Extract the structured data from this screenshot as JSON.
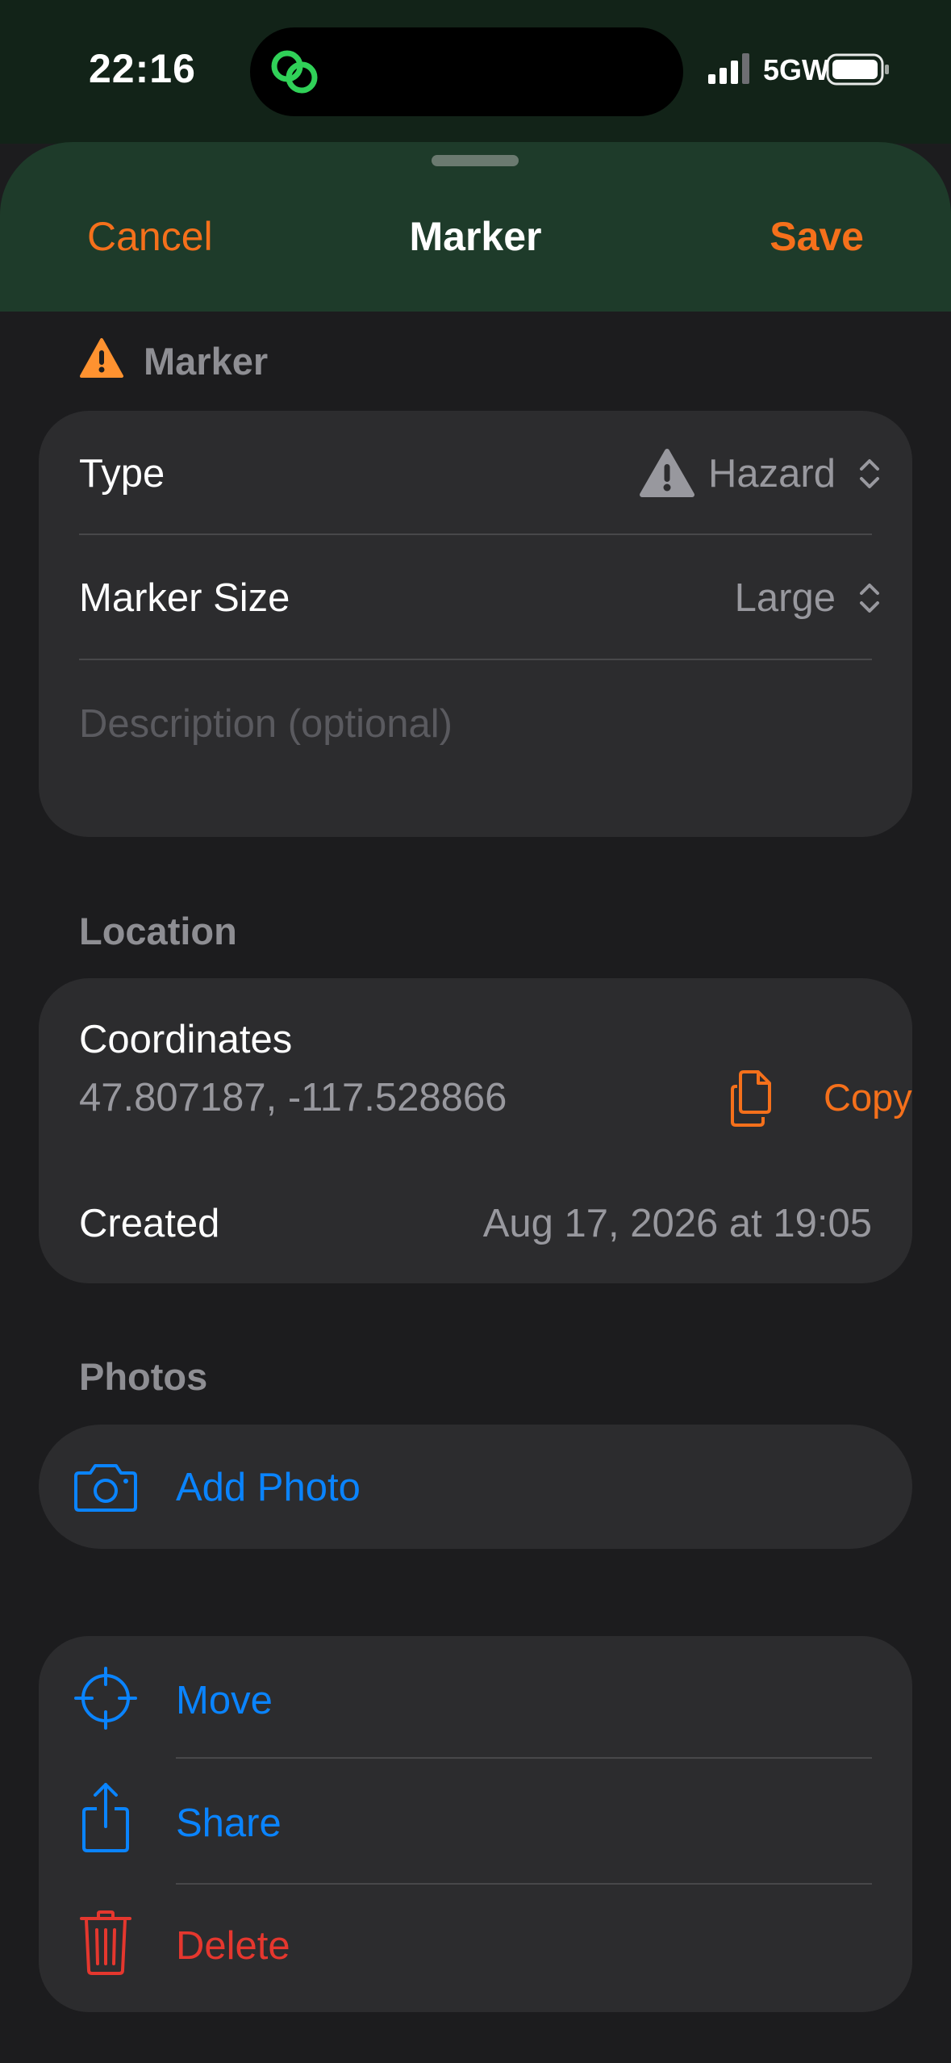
{
  "status_bar": {
    "time": "22:16",
    "network": "5GW",
    "island_icon": "linked-rings-icon"
  },
  "nav": {
    "cancel": "Cancel",
    "title": "Marker",
    "save": "Save"
  },
  "marker_section": {
    "header": "Marker",
    "header_icon": "warning-triangle-icon",
    "type_label": "Type",
    "type_value": "Hazard",
    "type_icon": "warning-triangle-icon",
    "size_label": "Marker Size",
    "size_value": "Large",
    "description_placeholder": "Description (optional)"
  },
  "location_section": {
    "header": "Location",
    "coordinates_label": "Coordinates",
    "coordinates_value": "47.807187, -117.528866",
    "copy_label": "Copy",
    "created_label": "Created",
    "created_value": "Aug 17, 2026 at 19:05"
  },
  "photos_section": {
    "header": "Photos",
    "add_photo": "Add Photo"
  },
  "actions": {
    "move": "Move",
    "share": "Share",
    "delete": "Delete"
  },
  "colors": {
    "accent_orange": "#f5701b",
    "link_blue": "#0a84ff",
    "destructive_red": "#e5372e",
    "header_green": "#1e3b2a",
    "background": "#1c1c1e",
    "card": "#2c2c2e"
  }
}
